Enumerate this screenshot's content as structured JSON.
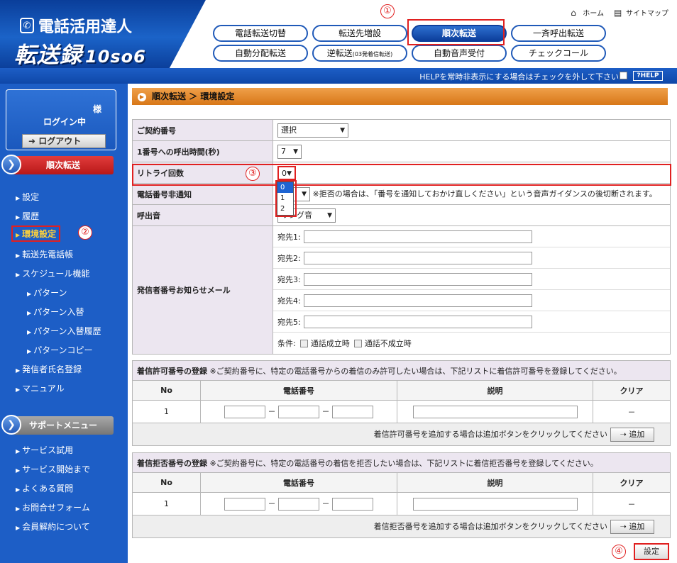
{
  "brand": {
    "line1": "電話活用達人",
    "line2": "転送録",
    "version": "10so6"
  },
  "top_links": {
    "home": "ホーム",
    "sitemap": "サイトマップ"
  },
  "tabs_row1": [
    "電話転送切替",
    "転送先増設",
    "順次転送",
    "一斉呼出転送"
  ],
  "tabs_row2": [
    "自動分配転送",
    "逆転送",
    "(03発着信転送)",
    "自動音声受付",
    "チェックコール"
  ],
  "help": {
    "text": "HELPを常時非表示にする場合はチェックを外して下さい",
    "button": "?HELP"
  },
  "user": {
    "honorific": "様",
    "status": "ログイン中",
    "logout": "ログアウト"
  },
  "sidebar": {
    "section1": "順次転送",
    "items": [
      "設定",
      "履歴",
      "環境設定",
      "転送先電話帳",
      "スケジュール機能",
      "パターン",
      "パターン入替",
      "パターン入替履歴",
      "パターンコピー",
      "発信者氏名登録",
      "マニュアル"
    ],
    "section2": "サポートメニュー",
    "items2": [
      "サービス試用",
      "サービス開始まで",
      "よくある質問",
      "お問合せフォーム",
      "会員解約について"
    ]
  },
  "breadcrumb": "順次転送 ＞ 環境設定",
  "settings": {
    "contract_label": "ご契約番号",
    "contract_value": "選択",
    "ring_label": "1番号への呼出時間(秒)",
    "ring_value": "7",
    "retry_label": "リトライ回数",
    "retry_value": "0",
    "retry_options": [
      "0",
      "1",
      "2"
    ],
    "notify_label": "電話番号非通知",
    "notify_note": "※拒否の場合は、「番号を通知しておかけ直しください」という音声ガイダンスの後切断されます。",
    "ring_tone_label": "呼出音",
    "ring_tone_value": "リング音",
    "mail_label": "発信者番号お知らせメール",
    "mail_fields": [
      "宛先1:",
      "宛先2:",
      "宛先3:",
      "宛先4:",
      "宛先5:"
    ],
    "condition_label": "条件:",
    "cond_ok": "通話成立時",
    "cond_ng": "通話不成立時"
  },
  "allow": {
    "title": "着信許可番号の登録",
    "note": "※ご契約番号に、特定の電話番号からの着信のみ許可したい場合は、下記リストに着信許可番号を登録してください。",
    "headers": [
      "No",
      "電話番号",
      "説明",
      "クリア"
    ],
    "row_no": "1",
    "dash": "－",
    "clear": "－",
    "add_text": "着信許可番号を追加する場合は追加ボタンをクリックしてください",
    "add_button": "追加"
  },
  "deny": {
    "title": "着信拒否番号の登録",
    "note": "※ご契約番号に、特定の電話番号の着信を拒否したい場合は、下記リストに着信拒否番号を登録してください。",
    "headers": [
      "No",
      "電話番号",
      "説明",
      "クリア"
    ],
    "row_no": "1",
    "dash": "－",
    "clear": "－",
    "add_text": "着信拒否番号を追加する場合は追加ボタンをクリックしてください",
    "add_button": "追加"
  },
  "submit": "設定",
  "markers": [
    "①",
    "②",
    "③",
    "④"
  ]
}
